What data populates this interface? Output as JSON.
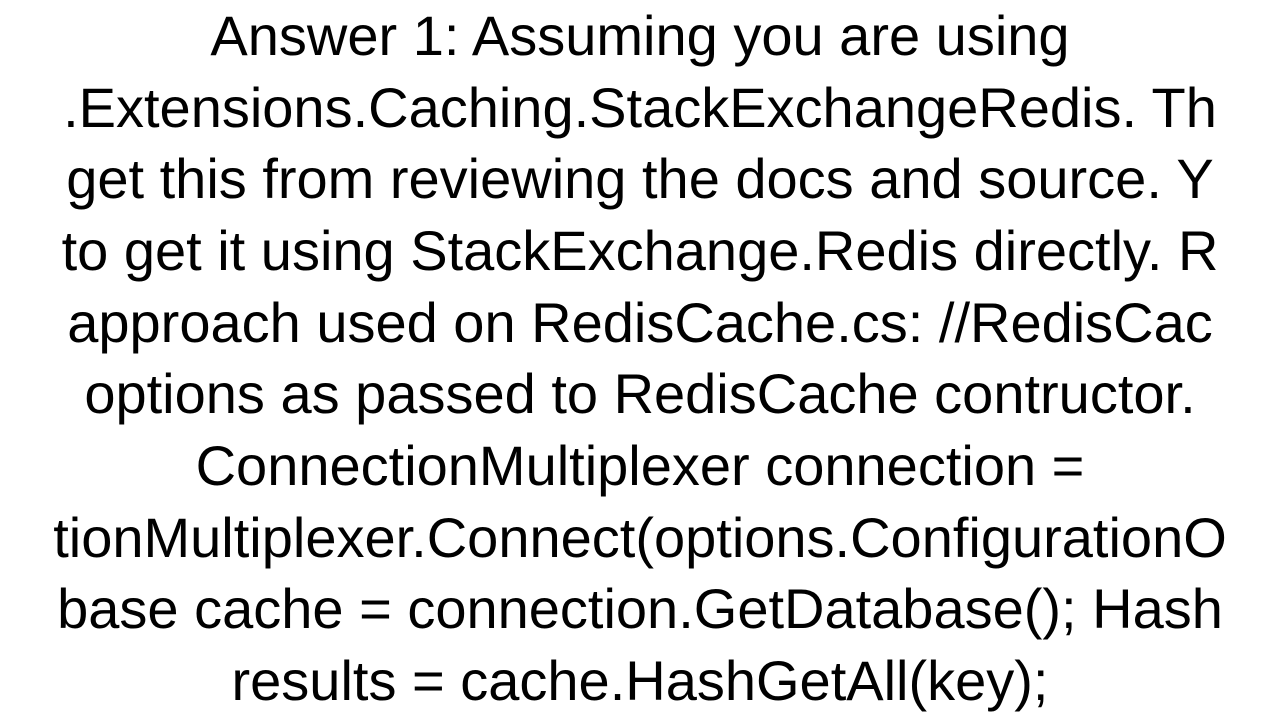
{
  "answer": {
    "lines": "Answer 1: Assuming you are using\n.Extensions.Caching.StackExchangeRedis. Th\n get this from reviewing the docs and source. Y\nto get it using StackExchange.Redis directly.  R\napproach used on RedisCache.cs: //RedisCac\noptions as passed to RedisCache contructor.\nConnectionMultiplexer connection =\ntionMultiplexer.Connect(options.ConfigurationO\nbase cache = connection.GetDatabase(); Hash\nresults = cache.HashGetAll(key);"
  }
}
